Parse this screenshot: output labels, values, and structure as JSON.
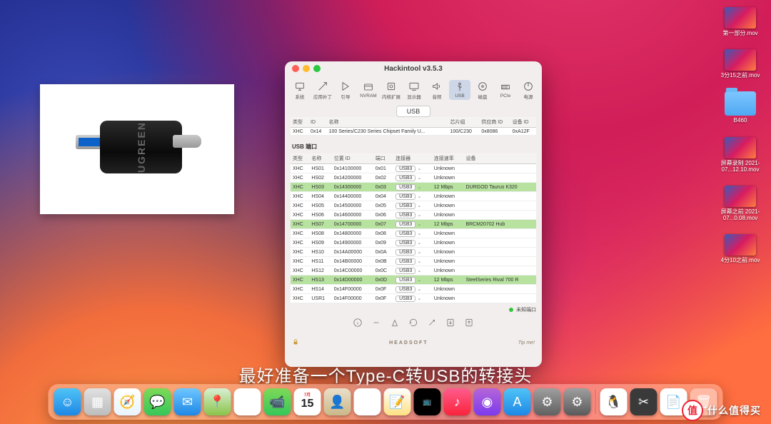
{
  "desktop": {
    "icons": [
      {
        "kind": "thumb",
        "label": "第一部分.mov"
      },
      {
        "kind": "thumb",
        "label": "3分15之前.mov"
      },
      {
        "kind": "folder",
        "label": "B460"
      },
      {
        "kind": "thumb",
        "label": "屏幕录制\n2021-07...12.10.mov"
      },
      {
        "kind": "thumb",
        "label": "屏幕之前\n2021-07...0.08.mov"
      },
      {
        "kind": "thumb",
        "label": "4分10之前.mov"
      }
    ]
  },
  "window": {
    "title": "Hackintool v3.5.3",
    "toolbar": [
      {
        "icon": "system",
        "label": "系统"
      },
      {
        "icon": "patch",
        "label": "应用补丁"
      },
      {
        "icon": "boot",
        "label": "引导"
      },
      {
        "icon": "nvram",
        "label": "NVRAM"
      },
      {
        "icon": "kext",
        "label": "内核扩展"
      },
      {
        "icon": "display",
        "label": "显示器"
      },
      {
        "icon": "audio",
        "label": "音频"
      },
      {
        "icon": "usb",
        "label": "USB",
        "selected": true
      },
      {
        "icon": "disk",
        "label": "磁盘"
      },
      {
        "icon": "pcie",
        "label": "PCIe"
      },
      {
        "icon": "power",
        "label": "电源"
      },
      {
        "icon": "refresh",
        "label": "",
        "right": true
      }
    ],
    "segment": "USB",
    "top_table": {
      "headers": [
        "类型",
        "ID",
        "名称",
        "芯片组",
        "供应商 ID",
        "设备 ID"
      ],
      "rows": [
        [
          "XHC",
          "0x14",
          "100 Series/C230 Series Chipset Family U...",
          "100/C230",
          "0x8086",
          "0xA12F"
        ]
      ]
    },
    "section_label": "USB 端口",
    "port_table": {
      "headers": [
        "类型",
        "名称",
        "位置 ID",
        "端口",
        "连接器",
        "连接速率",
        "设备"
      ],
      "rows": [
        {
          "c": [
            "XHC",
            "HS01",
            "0x14100000",
            "0x01",
            "USB3",
            "Unknown",
            ""
          ],
          "hl": false
        },
        {
          "c": [
            "XHC",
            "HS02",
            "0x14200000",
            "0x02",
            "USB3",
            "Unknown",
            ""
          ],
          "hl": false
        },
        {
          "c": [
            "XHC",
            "HS03",
            "0x14300000",
            "0x03",
            "USB3",
            "12 Mbps",
            "DURGOD Taurus K320"
          ],
          "hl": true
        },
        {
          "c": [
            "XHC",
            "HS04",
            "0x14400000",
            "0x04",
            "USB3",
            "Unknown",
            ""
          ],
          "hl": false
        },
        {
          "c": [
            "XHC",
            "HS05",
            "0x14500000",
            "0x05",
            "USB3",
            "Unknown",
            ""
          ],
          "hl": false
        },
        {
          "c": [
            "XHC",
            "HS06",
            "0x14600000",
            "0x06",
            "USB3",
            "Unknown",
            ""
          ],
          "hl": false
        },
        {
          "c": [
            "XHC",
            "HS07",
            "0x14700000",
            "0x07",
            "USB3",
            "12 Mbps",
            "BRCM20702 Hub"
          ],
          "hl": true
        },
        {
          "c": [
            "XHC",
            "HS08",
            "0x14800000",
            "0x08",
            "USB3",
            "Unknown",
            ""
          ],
          "hl": false
        },
        {
          "c": [
            "XHC",
            "HS09",
            "0x14900000",
            "0x09",
            "USB3",
            "Unknown",
            ""
          ],
          "hl": false
        },
        {
          "c": [
            "XHC",
            "HS10",
            "0x14A00000",
            "0x0A",
            "USB3",
            "Unknown",
            ""
          ],
          "hl": false
        },
        {
          "c": [
            "XHC",
            "HS11",
            "0x14B00000",
            "0x0B",
            "USB3",
            "Unknown",
            ""
          ],
          "hl": false
        },
        {
          "c": [
            "XHC",
            "HS12",
            "0x14C00000",
            "0x0C",
            "USB3",
            "Unknown",
            ""
          ],
          "hl": false
        },
        {
          "c": [
            "XHC",
            "HS13",
            "0x14D00000",
            "0x0D",
            "USB3",
            "12 Mbps",
            "SteelSeries Rival 700 R"
          ],
          "hl": true
        },
        {
          "c": [
            "XHC",
            "HS14",
            "0x14F00000",
            "0x0F",
            "USB3",
            "Unknown",
            ""
          ],
          "hl": false
        },
        {
          "c": [
            "XHC",
            "USR1",
            "0x14F00000",
            "0x0F",
            "USB3",
            "Unknown",
            ""
          ],
          "hl": false
        }
      ]
    },
    "status_label": "未知端口",
    "footer_brand": "HEADSOFT",
    "footer_tip": "Tip me!"
  },
  "caption": "最好准备一个Type-C转USB的转接头",
  "dock": {
    "apps": [
      {
        "name": "finder",
        "bg": "linear-gradient(#4fc3f7,#1e88e5)",
        "glyph": "☺"
      },
      {
        "name": "launchpad",
        "bg": "linear-gradient(#e0e0e0,#bdbdbd)",
        "glyph": "▦"
      },
      {
        "name": "safari",
        "bg": "linear-gradient(#fff,#e8f4ff)",
        "glyph": "🧭"
      },
      {
        "name": "messages",
        "bg": "linear-gradient(#7ed957,#34c759)",
        "glyph": "💬"
      },
      {
        "name": "mail",
        "bg": "linear-gradient(#6ec6ff,#1e88e5)",
        "glyph": "✉"
      },
      {
        "name": "maps",
        "bg": "linear-gradient(#d7f0d3,#8bc34a)",
        "glyph": "📍"
      },
      {
        "name": "photos",
        "bg": "#fff",
        "glyph": "✿"
      },
      {
        "name": "facetime",
        "bg": "linear-gradient(#7ed957,#34c759)",
        "glyph": "📹"
      },
      {
        "name": "calendar",
        "bg": "#fff",
        "glyph": "15"
      },
      {
        "name": "contacts",
        "bg": "linear-gradient(#e9dfc9,#cbb88a)",
        "glyph": "👤"
      },
      {
        "name": "reminders",
        "bg": "#fff",
        "glyph": "☰"
      },
      {
        "name": "notes",
        "bg": "linear-gradient(#fff,#ffe082)",
        "glyph": "📝"
      },
      {
        "name": "tv",
        "bg": "#000",
        "glyph": "tv"
      },
      {
        "name": "music",
        "bg": "linear-gradient(#ff5c8d,#fa233b)",
        "glyph": "♪"
      },
      {
        "name": "podcasts",
        "bg": "linear-gradient(#b565d8,#7c3aed)",
        "glyph": "◉"
      },
      {
        "name": "appstore",
        "bg": "linear-gradient(#4fc3f7,#1e88e5)",
        "glyph": "A"
      },
      {
        "name": "preferences",
        "bg": "linear-gradient(#9e9e9e,#616161)",
        "glyph": "⚙"
      },
      {
        "name": "hackintool",
        "bg": "linear-gradient(#9e9e9e,#5a5a5a)",
        "glyph": "⚙"
      }
    ],
    "extras": [
      {
        "name": "qq",
        "bg": "#fff",
        "glyph": "🐧"
      },
      {
        "name": "screenshot",
        "bg": "#3a3a3a",
        "glyph": "✂"
      },
      {
        "name": "pages",
        "bg": "#fff",
        "glyph": "📄"
      },
      {
        "name": "trash",
        "bg": "rgba(255,255,255,.35)",
        "glyph": "🗑"
      }
    ]
  },
  "watermark": {
    "badge": "值",
    "text": "什么值得买"
  }
}
